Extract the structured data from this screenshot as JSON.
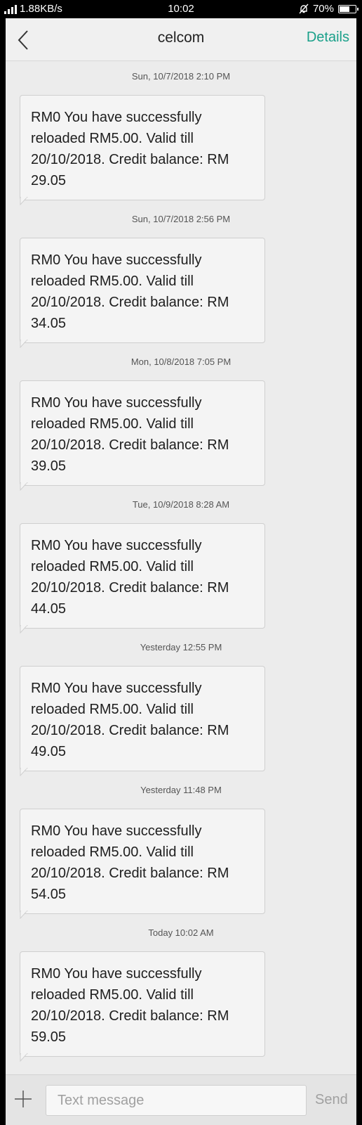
{
  "status_bar": {
    "network_speed": "1.88KB/s",
    "time": "10:02",
    "battery_percent": "70%",
    "battery_level": 0.7
  },
  "header": {
    "title": "celcom",
    "details_label": "Details"
  },
  "messages": [
    {
      "timestamp": "Sun, 10/7/2018  2:10 PM",
      "lines": [
        "RM0 You have successfully",
        "reloaded RM5.00. Valid till",
        "20/10/2018. Credit balance: RM",
        "29.05"
      ]
    },
    {
      "timestamp": "Sun, 10/7/2018  2:56 PM",
      "lines": [
        "RM0 You have successfully",
        "reloaded RM5.00. Valid till",
        "20/10/2018. Credit balance: RM",
        "34.05"
      ]
    },
    {
      "timestamp": "Mon, 10/8/2018  7:05 PM",
      "lines": [
        "RM0 You have successfully",
        "reloaded RM5.00. Valid till",
        "20/10/2018. Credit balance: RM",
        "39.05"
      ]
    },
    {
      "timestamp": "Tue, 10/9/2018  8:28 AM",
      "lines": [
        "RM0 You have successfully",
        "reloaded RM5.00. Valid till",
        "20/10/2018. Credit balance: RM",
        "44.05"
      ]
    },
    {
      "timestamp": "Yesterday  12:55 PM",
      "lines": [
        "RM0 You have successfully",
        "reloaded RM5.00. Valid till",
        "20/10/2018. Credit balance: RM",
        "49.05"
      ]
    },
    {
      "timestamp": "Yesterday  11:48 PM",
      "lines": [
        "RM0 You have successfully",
        "reloaded RM5.00. Valid till",
        "20/10/2018. Credit balance: RM",
        "54.05"
      ]
    },
    {
      "timestamp": "Today  10:02 AM",
      "lines": [
        "RM0 You have successfully",
        "reloaded RM5.00. Valid till",
        "20/10/2018. Credit balance: RM",
        "59.05"
      ]
    }
  ],
  "composer": {
    "placeholder": "Text message",
    "send_label": "Send"
  },
  "colors": {
    "accent": "#1aa08a",
    "background": "#ececec",
    "bubble": "#f4f4f4"
  },
  "icons": {
    "back": "chevron-left-icon",
    "add": "plus-icon",
    "mute": "bell-off-icon",
    "signal": "signal-icon",
    "battery": "battery-icon"
  }
}
